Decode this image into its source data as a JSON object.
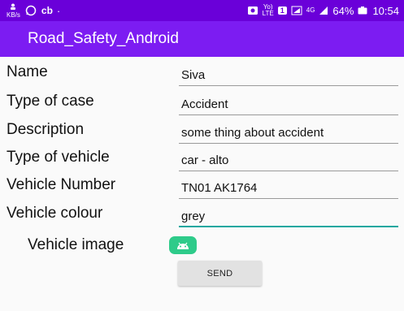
{
  "status_bar": {
    "left_glyphs": [
      "cb",
      "·"
    ],
    "net_top": "KB/s",
    "lte": "Yo)\nLTE",
    "sim_badge": "1",
    "network_type": "4G",
    "battery": "64%",
    "time": "10:54"
  },
  "app": {
    "title": "Road_Safety_Android"
  },
  "form": {
    "fields": [
      {
        "label": "Name",
        "value": "Siva"
      },
      {
        "label": "Type of case",
        "value": "Accident"
      },
      {
        "label": "Description",
        "value": "some thing about accident"
      },
      {
        "label": "Type of vehicle",
        "value": "car - alto"
      },
      {
        "label": "Vehicle Number",
        "value": "TN01 AK1764"
      },
      {
        "label": "Vehicle colour",
        "value": "grey"
      }
    ],
    "image_label": "Vehicle image",
    "send_label": "SEND"
  },
  "colors": {
    "status_bar": "#6a00d9",
    "app_bar": "#7c1cf2",
    "active_underline": "#1aa7a0",
    "image_button": "#2ecb8a"
  }
}
